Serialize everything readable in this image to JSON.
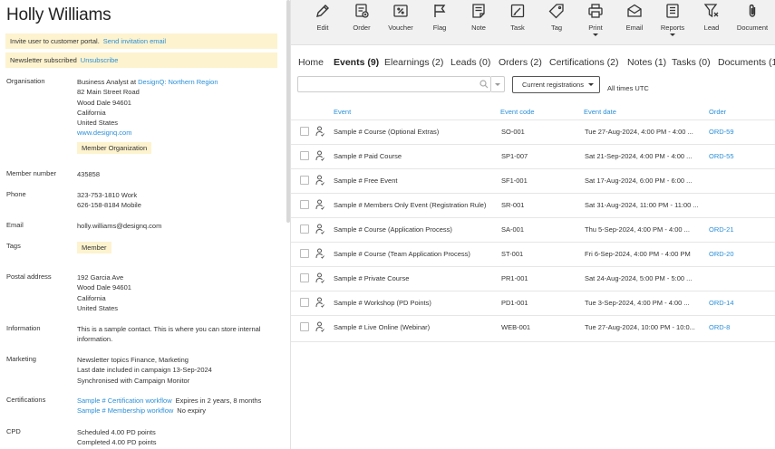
{
  "contact": {
    "name": "Holly Williams",
    "notices": {
      "portal": {
        "text": "Invite user to customer portal.",
        "link": "Send invitation email"
      },
      "newsletter": {
        "text": "Newsletter subscribed",
        "link": "Unsubscribe"
      }
    },
    "organisation": {
      "label": "Organisation",
      "role_prefix": "Business Analyst at",
      "org_link": "DesignQ: Northern Region",
      "street": "82 Main Street Road",
      "city": "Wood Dale 94601",
      "state": "California",
      "country": "United States",
      "website": "www.designq.com",
      "tag": "Member Organization"
    },
    "member_number": {
      "label": "Member number",
      "value": "435858"
    },
    "phone": {
      "label": "Phone",
      "work": "323-753-1810 Work",
      "mobile": "626-158-8184 Mobile"
    },
    "email": {
      "label": "Email",
      "value": "holly.williams@designq.com"
    },
    "tags": {
      "label": "Tags",
      "value": "Member"
    },
    "postal": {
      "label": "Postal address",
      "street": "192 Garcia Ave",
      "city": "Wood Dale 94601",
      "state": "California",
      "country": "United States"
    },
    "information": {
      "label": "Information",
      "line1": "This is a sample contact. This is where you can store internal",
      "line2": "information."
    },
    "marketing": {
      "label": "Marketing",
      "line1": "Newsletter topics Finance, Marketing",
      "line2": "Last date included in campaign 13-Sep-2024",
      "line3": "Synchronised with Campaign Monitor"
    },
    "certifications": {
      "label": "Certifications",
      "items": [
        {
          "name": "Sample # Certification workflow",
          "status": "Expires in 2 years, 8 months"
        },
        {
          "name": "Sample # Membership workflow",
          "status": "No expiry"
        }
      ]
    },
    "cpd": {
      "label": "CPD",
      "scheduled": "Scheduled 4.00 PD points",
      "completed": "Completed 4.00 PD points"
    }
  },
  "toolbar": {
    "items": [
      {
        "label": "Edit",
        "icon": "pencil-icon"
      },
      {
        "label": "Order",
        "icon": "order-icon"
      },
      {
        "label": "Voucher",
        "icon": "voucher-icon"
      },
      {
        "label": "Flag",
        "icon": "flag-icon"
      },
      {
        "label": "Note",
        "icon": "note-icon"
      },
      {
        "label": "Task",
        "icon": "task-icon"
      },
      {
        "label": "Tag",
        "icon": "tag-icon"
      },
      {
        "label": "Print",
        "icon": "printer-icon"
      },
      {
        "label": "Email",
        "icon": "envelope-icon"
      },
      {
        "label": "Reports",
        "icon": "reports-icon"
      },
      {
        "label": "Lead",
        "icon": "lead-filter-icon"
      },
      {
        "label": "Document",
        "icon": "paperclip-icon"
      }
    ]
  },
  "tabs": [
    "Home",
    "Events (9)",
    "Elearnings (2)",
    "Leads (0)",
    "Orders (2)",
    "Certifications (2)",
    "Notes (1)",
    "Tasks (0)",
    "Documents (1"
  ],
  "filters": {
    "search_placeholder": "",
    "registration_filter": "Current registrations",
    "timezone_note": "All times UTC"
  },
  "table": {
    "columns": [
      "Event",
      "Event code",
      "Event date",
      "Order"
    ],
    "rows": [
      {
        "event": "Sample # Course (Optional Extras)",
        "code": "SO-001",
        "date": "Tue 27-Aug-2024, 4:00 PM - 4:00 ...",
        "order": "ORD-59"
      },
      {
        "event": "Sample # Paid Course",
        "code": "SP1-007",
        "date": "Sat 21-Sep-2024, 4:00 PM - 4:00 ...",
        "order": "ORD-55"
      },
      {
        "event": "Sample # Free Event",
        "code": "SF1-001",
        "date": "Sat 17-Aug-2024, 6:00 PM - 6:00 ...",
        "order": ""
      },
      {
        "event": "Sample # Members Only Event (Registration Rule)",
        "code": "SR-001",
        "date": "Sat 31-Aug-2024, 11:00 PM - 11:00 ...",
        "order": ""
      },
      {
        "event": "Sample # Course (Application Process)",
        "code": "SA-001",
        "date": "Thu 5-Sep-2024, 4:00 PM - 4:00 ...",
        "order": "ORD-21"
      },
      {
        "event": "Sample # Course (Team Application Process)",
        "code": "ST-001",
        "date": "Fri 6-Sep-2024, 4:00 PM - 4:00 PM",
        "order": "ORD-20"
      },
      {
        "event": "Sample # Private Course",
        "code": "PR1-001",
        "date": "Sat 24-Aug-2024, 5:00 PM - 5:00 ...",
        "order": ""
      },
      {
        "event": "Sample # Workshop (PD Points)",
        "code": "PD1-001",
        "date": "Tue 3-Sep-2024, 4:00 PM - 4:00 ...",
        "order": "ORD-14"
      },
      {
        "event": "Sample # Live Online (Webinar)",
        "code": "WEB-001",
        "date": "Tue 27-Aug-2024, 10:00 PM - 10:0...",
        "order": "ORD-8"
      }
    ]
  },
  "colors": {
    "accent": "#2a8fd8",
    "highlight": "#fdf3cf",
    "toolbar_bg": "#f1f1f1"
  }
}
